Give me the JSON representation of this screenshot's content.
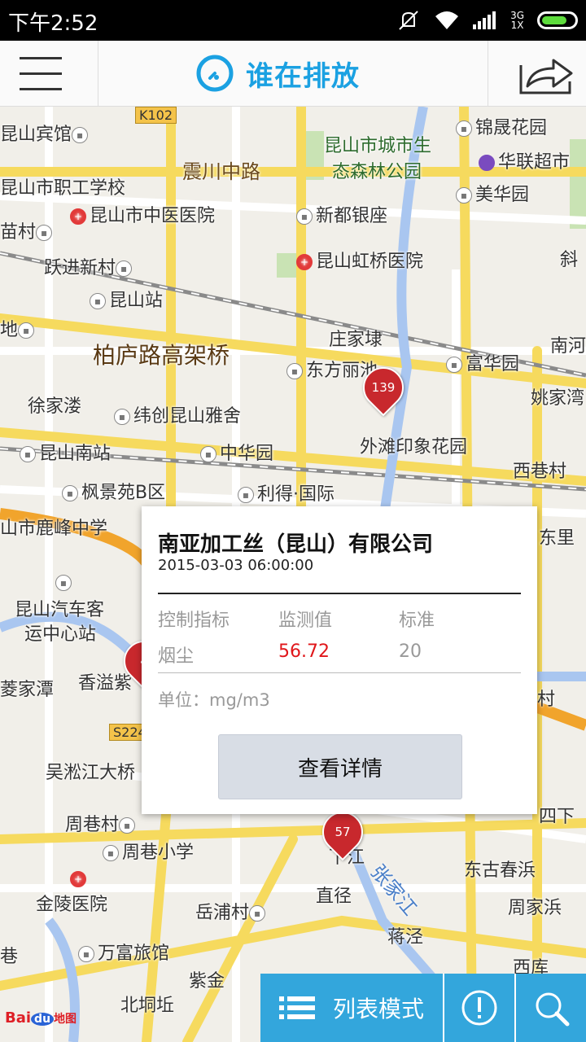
{
  "status_bar": {
    "time": "下午2:52",
    "network_label_top": "3G",
    "network_label_bottom": "1X"
  },
  "header": {
    "title": "谁在排放",
    "menu_icon": "hamburger-menu-icon",
    "logo_icon": "app-logo-icon",
    "share_icon": "share-icon"
  },
  "map": {
    "pois": [
      {
        "label": "昆山宾馆"
      },
      {
        "label": "锦晟花园"
      },
      {
        "label": "昆山市城市生"
      },
      {
        "label": "态森林公园"
      },
      {
        "label": "震川中路"
      },
      {
        "label": "华联超市"
      },
      {
        "label": "昆山市职工学校"
      },
      {
        "label": "美华园"
      },
      {
        "label": "昆山市中医医院"
      },
      {
        "label": "新都银座"
      },
      {
        "label": "苗村"
      },
      {
        "label": "斜"
      },
      {
        "label": "跃进新村"
      },
      {
        "label": "昆山虹桥医院"
      },
      {
        "label": "昆山站"
      },
      {
        "label": "地"
      },
      {
        "label": "庄家埭"
      },
      {
        "label": "南河"
      },
      {
        "label": "柏庐路高架桥"
      },
      {
        "label": "东方丽池"
      },
      {
        "label": "富华园"
      },
      {
        "label": "徐家溇"
      },
      {
        "label": "纬创昆山雅舍"
      },
      {
        "label": "姚家湾"
      },
      {
        "label": "昆山南站"
      },
      {
        "label": "中华园"
      },
      {
        "label": "外滩印象花园"
      },
      {
        "label": "西巷村"
      },
      {
        "label": "枫景苑B区"
      },
      {
        "label": "利得·国际"
      },
      {
        "label": "山市鹿峰中学"
      },
      {
        "label": "东里"
      },
      {
        "label": "昆山汽车客"
      },
      {
        "label": "运中心站"
      },
      {
        "label": "菱家潭"
      },
      {
        "label": "香溢紫"
      },
      {
        "label": "村"
      },
      {
        "label": "吴淞江大桥"
      },
      {
        "label": "周巷村"
      },
      {
        "label": "四下"
      },
      {
        "label": "周巷小学"
      },
      {
        "label": "下江"
      },
      {
        "label": "东古春浜"
      },
      {
        "label": "金陵医院"
      },
      {
        "label": "直径"
      },
      {
        "label": "岳浦村"
      },
      {
        "label": "周家浜"
      },
      {
        "label": "蒋泾"
      },
      {
        "label": "巷"
      },
      {
        "label": "万富旅馆"
      },
      {
        "label": "紫金"
      },
      {
        "label": "西库"
      },
      {
        "label": "北垌坵"
      },
      {
        "label": "张家江"
      }
    ],
    "road_shields": [
      "K102",
      "S224"
    ],
    "markers": [
      {
        "value": "139"
      },
      {
        "value": "4"
      },
      {
        "value": "57"
      }
    ]
  },
  "popup": {
    "company": "南亚加工丝（昆山）有限公司",
    "timestamp": "2015-03-03 06:00:00",
    "headers": {
      "indicator": "控制指标",
      "measured": "监测值",
      "standard": "标准"
    },
    "row": {
      "indicator": "烟尘",
      "measured": "56.72",
      "standard": "20"
    },
    "unit": "单位：mg/m3",
    "detail_button": "查看详情",
    "measured_color": "#e0161a"
  },
  "bottom_bar": {
    "list_mode_label": "列表模式",
    "list_icon": "list-icon",
    "alert_icon": "alert-icon",
    "search_icon": "search-icon",
    "accent_color": "#33a6dc"
  },
  "map_logo": {
    "baidu": "Bai",
    "du": "du",
    "map_text": "地图"
  }
}
